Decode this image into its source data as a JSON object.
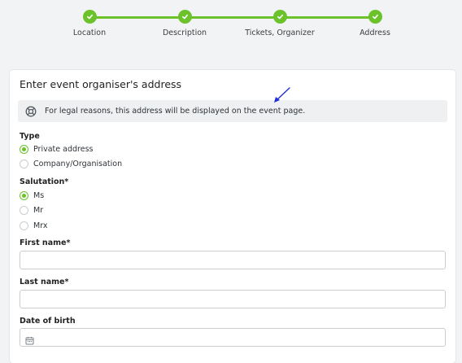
{
  "stepper": {
    "steps": [
      {
        "label": "Location",
        "state": "completed"
      },
      {
        "label": "Description",
        "state": "completed"
      },
      {
        "label": "Tickets, Organizer",
        "state": "completed"
      },
      {
        "label": "Address",
        "state": "completed"
      }
    ],
    "color": "#6cc22b",
    "icon": "check-icon"
  },
  "form": {
    "title": "Enter event organiser's address",
    "info": {
      "icon": "lifebuoy-icon",
      "text": "For legal reasons, this address will be displayed on the event page."
    },
    "type": {
      "label": "Type",
      "options": [
        {
          "label": "Private address",
          "checked": true
        },
        {
          "label": "Company/Organisation",
          "checked": false
        }
      ]
    },
    "salutation": {
      "label": "Salutation*",
      "options": [
        {
          "label": "Ms",
          "checked": true
        },
        {
          "label": "Mr",
          "checked": false
        },
        {
          "label": "Mrx",
          "checked": false
        }
      ]
    },
    "first_name": {
      "label": "First name*",
      "value": ""
    },
    "last_name": {
      "label": "Last name*",
      "value": ""
    },
    "date_of_birth": {
      "label": "Date of birth",
      "value": "",
      "icon": "calendar-icon"
    }
  },
  "annotation": {
    "icon": "arrow-icon",
    "color": "#1f2fd6"
  }
}
